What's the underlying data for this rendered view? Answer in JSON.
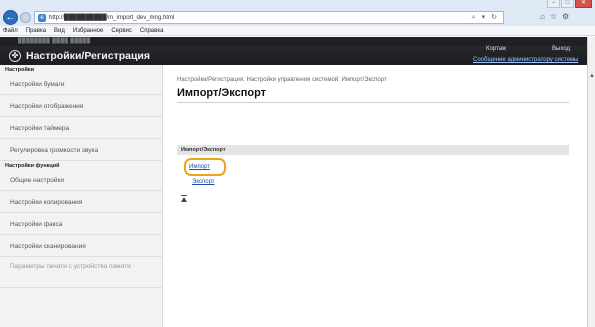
{
  "browser": {
    "url": "http://██████████/m_import_dev_mng.html",
    "address_icons": "⌕ ▾ ↻",
    "window_controls": {
      "minimize": "−",
      "maximize": "□",
      "close": "✕"
    },
    "menu": [
      "Файл",
      "Правка",
      "Вид",
      "Избранное",
      "Сервис",
      "Справка"
    ]
  },
  "header": {
    "model_text": "████████  ████  █████",
    "title": "Настройки/Регистрация",
    "user": "Кортаж",
    "logout": "Выход",
    "mail_admin": "Сообщение администратору системы"
  },
  "sidebar": {
    "heading1": "Настройки",
    "group1": [
      "Настройки бумаги",
      "Настройки отображения",
      "Настройки таймера",
      "Регулировка громкости звука"
    ],
    "heading2": "Настройки функций",
    "group2": [
      "Общие настройки",
      "Настройки копирования",
      "Настройки факса",
      "Настройки сканирования",
      "Параметры печати с устройства памяти"
    ]
  },
  "main": {
    "breadcrumb": "Настройки/Регистрация: Настройки управления системой: Импорт/Экспорт",
    "title": "Импорт/Экспорт",
    "section_label": "Импорт/Экспорт",
    "import_link": "Импорт",
    "export_link": "Экспорт"
  },
  "colors": {
    "header_bg": "#1c1d22",
    "link": "#1d4ea8",
    "highlight": "#f0a21c",
    "sidebar_bg": "#f2f2f2"
  }
}
